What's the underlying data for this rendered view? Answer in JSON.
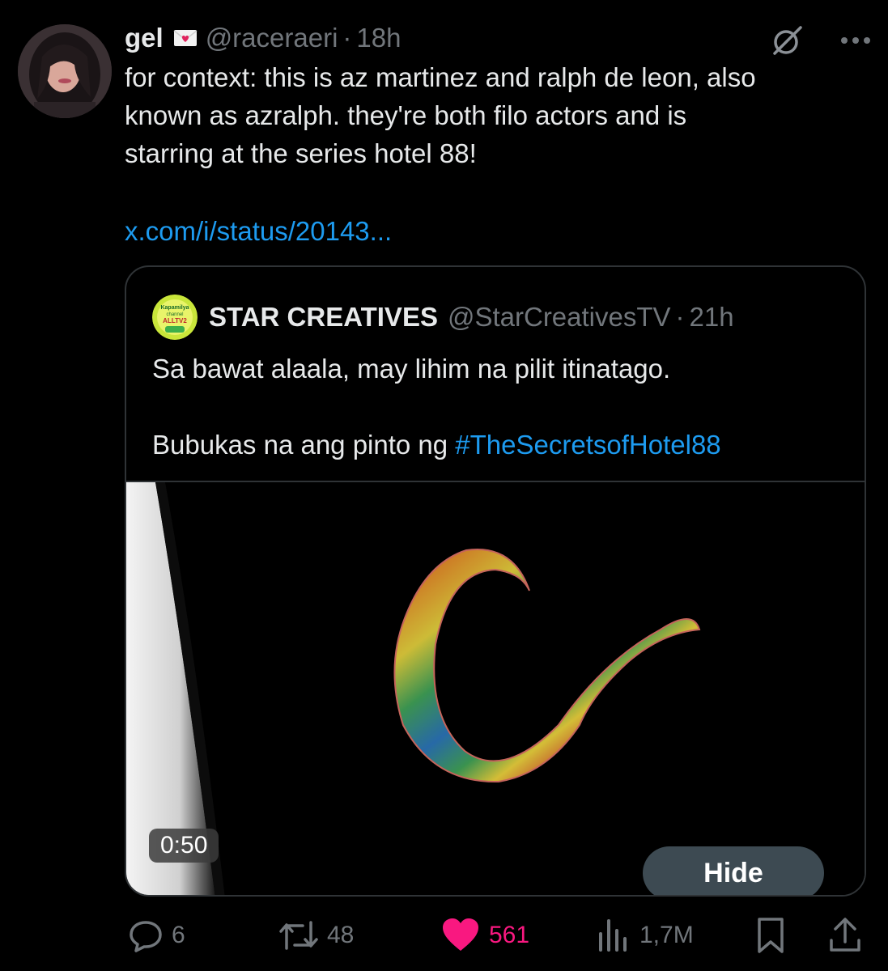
{
  "tweet": {
    "author_name": "gel",
    "author_handle": "@raceraeri",
    "separator": "·",
    "time": "18h",
    "text_lines": [
      "for context: this is az martinez and ralph de leon, also",
      "known as azralph. they're both filo actors and is",
      "starring at the series hotel 88!"
    ],
    "link": "x.com/i/status/20143..."
  },
  "quote": {
    "author_name": "STAR CREATIVES",
    "author_handle": "@StarCreativesTV",
    "separator": "·",
    "time": "21h",
    "text_line1": "Sa bawat alaala, may lihim na pilit itinatago.",
    "text_line2_prefix": "Bubukas na ang pinto ng ",
    "hashtag": "#TheSecretsofHotel88",
    "avatar_text": "Kapamilya channel ALLTV2",
    "video_duration": "0:50",
    "hide_label": "Hide"
  },
  "actions": {
    "replies": "6",
    "reposts": "48",
    "likes": "561",
    "views": "1,7M"
  },
  "colors": {
    "background": "#000000",
    "text": "#e7e9ea",
    "muted": "#71767b",
    "link": "#1d9bf0",
    "like": "#f91880",
    "border": "#2f3336"
  }
}
